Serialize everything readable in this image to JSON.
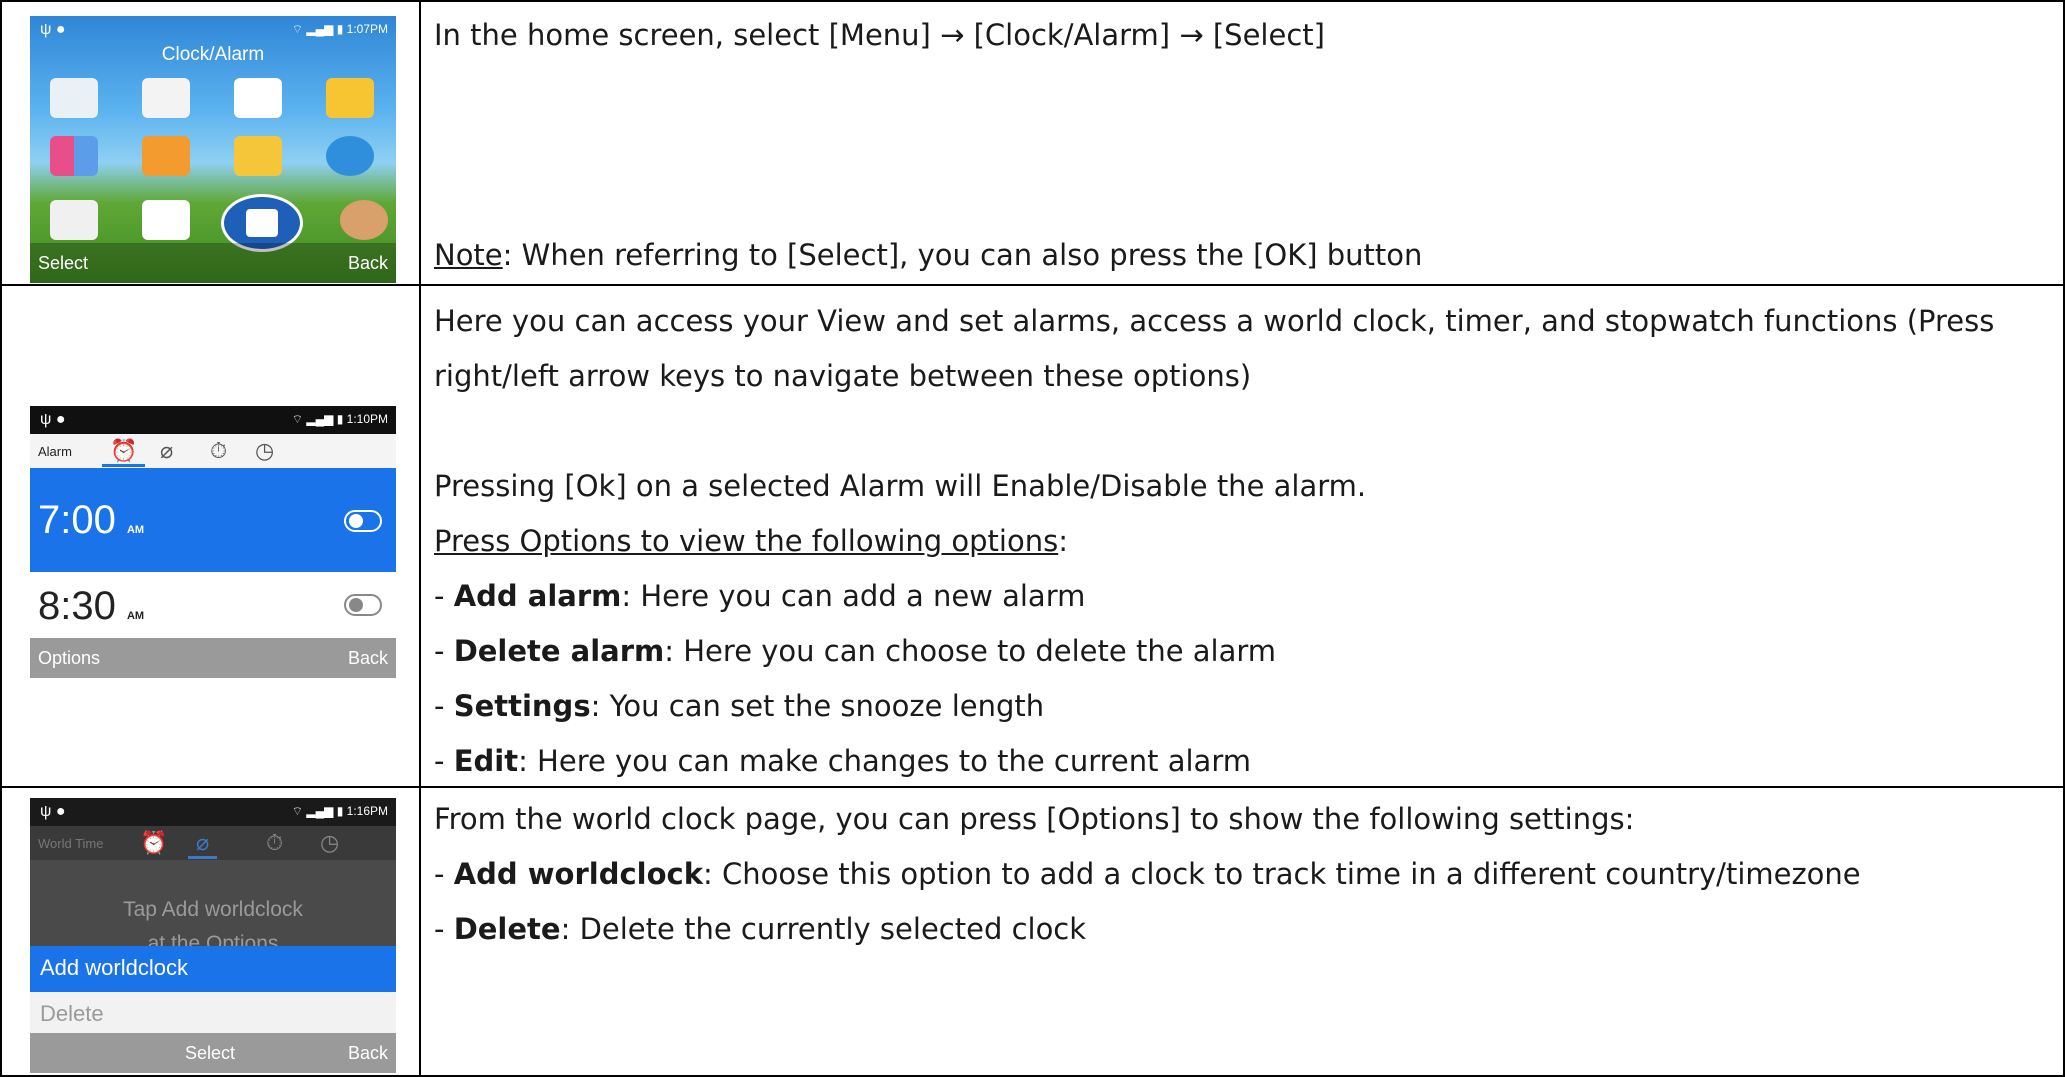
{
  "rows": [
    {
      "screen": {
        "status_time": "1:07PM",
        "title": "Clock/Alarm",
        "softkey_left": "Select",
        "softkey_right": "Back"
      },
      "lines": [
        "In the home screen, select [Menu] → [Clock/Alarm] → [Select]"
      ],
      "note_label": "Note",
      "note_text": ": When referring to [Select], you can also press the [OK] button"
    },
    {
      "screen": {
        "status_time": "1:10PM",
        "tab_label": "Alarm",
        "alarms": [
          {
            "time": "7:00",
            "ampm": "AM",
            "enabled": true
          },
          {
            "time": "8:30",
            "ampm": "AM",
            "enabled": false
          }
        ],
        "softkey_left": "Options",
        "softkey_right": "Back"
      },
      "line1": "Here you can access your View and set alarms, access a world clock, timer, and stopwatch functions (Press",
      "line2": "right/left arrow keys to navigate between these options)",
      "line3": "Pressing [Ok] on a selected Alarm will Enable/Disable the alarm.",
      "options_intro": "Press Options to view the following options",
      "options_colon": ":",
      "items": [
        {
          "term": "Add alarm",
          "desc": ": Here you can add a new alarm"
        },
        {
          "term": "Delete alarm",
          "desc": ": Here you can choose to delete the alarm"
        },
        {
          "term": "Settings",
          "desc": ": You can set the snooze length"
        },
        {
          "term": "Edit",
          "desc": ": Here you can make changes to the current alarm"
        }
      ]
    },
    {
      "screen": {
        "status_time": "1:16PM",
        "tab_label": "World Time",
        "hint_line1": "Tap Add worldclock",
        "hint_line2": "at the Options",
        "option_selected": "Add worldclock",
        "option_disabled": "Delete",
        "softkey_center": "Select",
        "softkey_right": "Back"
      },
      "line1": "From the world clock page, you can press [Options] to show the following settings:",
      "items": [
        {
          "term": "Add worldclock",
          "desc": ": Choose this option to add a clock to track time in a different country/timezone"
        },
        {
          "term": "Delete",
          "desc": ": Delete the currently selected clock"
        }
      ]
    }
  ],
  "colors": {
    "accent_blue": "#1a73e8",
    "softkey_gray": "#9a9a9a",
    "border": "#000000"
  },
  "icons": [
    "usb-icon",
    "android-icon",
    "wifi-icon",
    "signal-icon",
    "battery-icon",
    "alarm-clock-icon",
    "world-icon",
    "timer-icon",
    "stopwatch-icon",
    "toggle-icon"
  ]
}
